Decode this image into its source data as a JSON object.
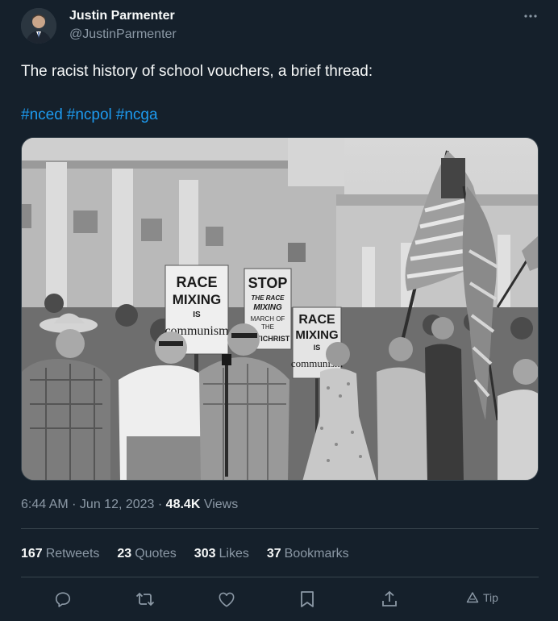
{
  "author": {
    "name": "Justin Parmenter",
    "handle": "@JustinParmenter"
  },
  "tweet": {
    "text": "The racist history of school vouchers, a brief thread:",
    "hashtags": [
      "#nced",
      "#ncpol",
      "#ncga"
    ]
  },
  "photo": {
    "signs": [
      {
        "lines": [
          "RACE",
          "MIXING",
          "IS",
          "communism"
        ]
      },
      {
        "lines": [
          "STOP",
          "THE RACE",
          "MIXING",
          "MARCH OF",
          "THE",
          "ANTICHRIST"
        ]
      },
      {
        "lines": [
          "RACE",
          "MIXING",
          "IS",
          "communism"
        ]
      }
    ]
  },
  "meta": {
    "time": "6:44 AM · Jun 12, 2023 · ",
    "views_count": "48.4K",
    "views_label": " Views"
  },
  "stats": [
    {
      "count": "167",
      "label": "Retweets"
    },
    {
      "count": "23",
      "label": "Quotes"
    },
    {
      "count": "303",
      "label": "Likes"
    },
    {
      "count": "37",
      "label": "Bookmarks"
    }
  ],
  "actions": {
    "reply_icon": "reply-icon",
    "retweet_icon": "retweet-icon",
    "like_icon": "heart-icon",
    "bookmark_icon": "bookmark-icon",
    "share_icon": "share-icon",
    "tip_label": "Tip"
  },
  "colors": {
    "background": "#15202b",
    "accent": "#1d9bf0",
    "muted": "#8b98a5",
    "divider": "#38444d"
  }
}
